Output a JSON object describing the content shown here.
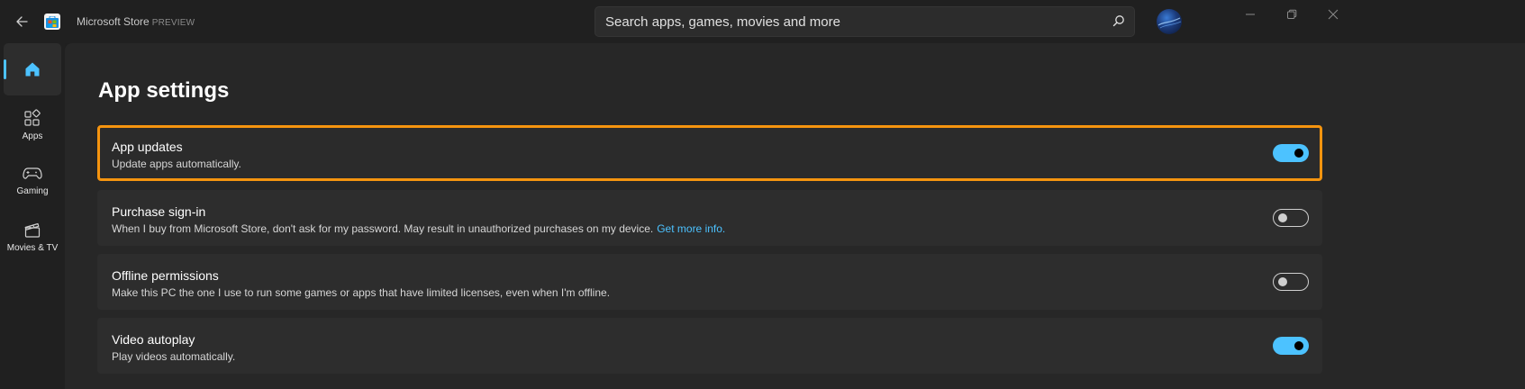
{
  "titlebar": {
    "app_name": "Microsoft Store",
    "preview_badge": "PREVIEW",
    "back_icon": "arrow-left-icon",
    "logo_icon": "microsoft-store-logo"
  },
  "search": {
    "placeholder": "Search apps, games, movies and more",
    "value": "",
    "icon": "search-icon"
  },
  "window_controls": {
    "minimize_icon": "minimize-icon",
    "restore_icon": "restore-icon",
    "close_icon": "close-icon"
  },
  "sidebar": {
    "items": [
      {
        "id": "home",
        "label": "",
        "icon": "home-icon",
        "active": true
      },
      {
        "id": "apps",
        "label": "Apps",
        "icon": "apps-icon",
        "active": false
      },
      {
        "id": "gaming",
        "label": "Gaming",
        "icon": "gamepad-icon",
        "active": false
      },
      {
        "id": "movies",
        "label": "Movies & TV",
        "icon": "clapperboard-icon",
        "active": false
      }
    ]
  },
  "main": {
    "title": "App settings",
    "settings": [
      {
        "id": "app-updates",
        "title": "App updates",
        "description": "Update apps automatically.",
        "enabled": true,
        "focused": true
      },
      {
        "id": "purchase-sign-in",
        "title": "Purchase sign-in",
        "description": "When I buy from Microsoft Store, don't ask for my password. May result in unauthorized purchases on my device.",
        "link": "Get more info.",
        "enabled": false,
        "focused": false
      },
      {
        "id": "offline-permissions",
        "title": "Offline permissions",
        "description": "Make this PC the one I use to run some games or apps that have limited licenses, even when I'm offline.",
        "enabled": false,
        "focused": false
      },
      {
        "id": "video-autoplay",
        "title": "Video autoplay",
        "description": "Play videos automatically.",
        "enabled": true,
        "focused": false
      }
    ]
  },
  "colors": {
    "accent": "#4cc2ff",
    "focus_border": "#f5940f",
    "background": "#272727",
    "card": "#2d2d2d",
    "titlebar": "#202020"
  }
}
